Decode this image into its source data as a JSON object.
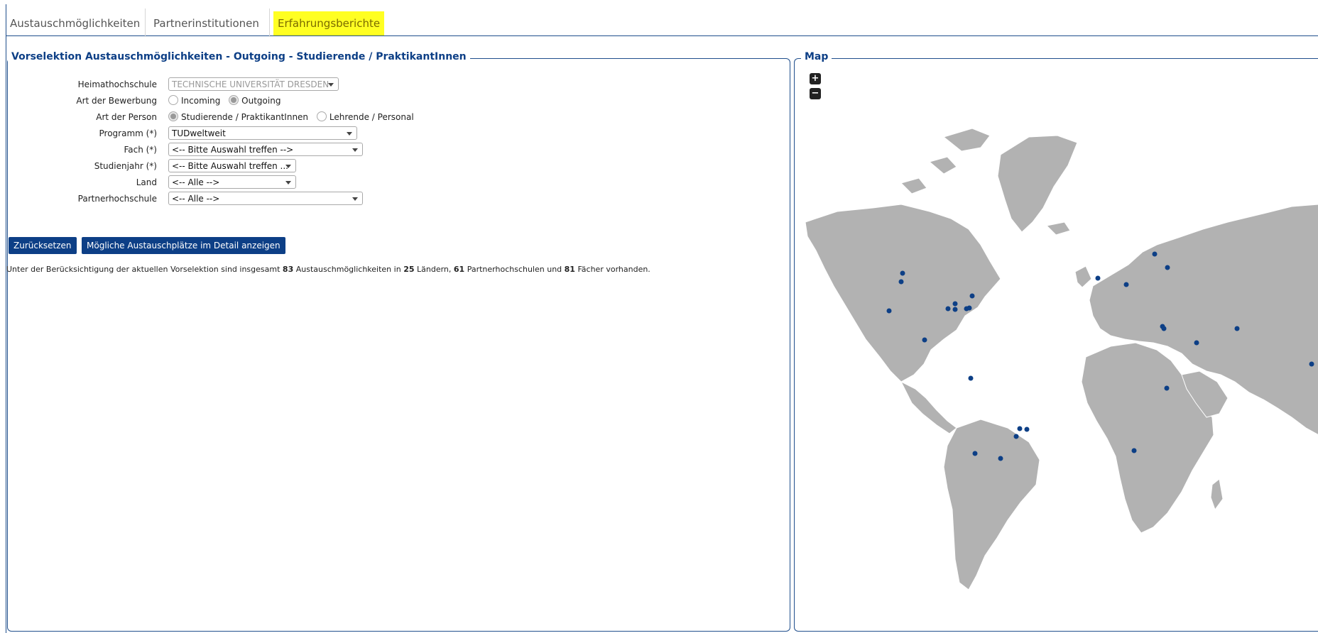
{
  "tabs": [
    {
      "label": "Austauschmöglichkeiten"
    },
    {
      "label": "Partnerinstitutionen"
    },
    {
      "label": "Erfahrungsberichte"
    }
  ],
  "selection": {
    "legend": "Vorselektion Austauschmöglichkeiten - Outgoing - Studierende / PraktikantInnen",
    "fields": {
      "heimathochschule": {
        "label": "Heimathochschule",
        "value": "TECHNISCHE UNIVERSITÄT DRESDEN"
      },
      "bewerbung": {
        "label": "Art der Bewerbung",
        "options": [
          "Incoming",
          "Outgoing"
        ],
        "selected": "Outgoing"
      },
      "person": {
        "label": "Art der Person",
        "options": [
          "Studierende / PraktikantInnen",
          "Lehrende / Personal"
        ],
        "selected": "Studierende / PraktikantInnen"
      },
      "programm": {
        "label": "Programm (*)",
        "value": "TUDweltweit"
      },
      "fach": {
        "label": "Fach (*)",
        "value": "<-- Bitte Auswahl treffen -->"
      },
      "studienjahr": {
        "label": "Studienjahr (*)",
        "value": "<-- Bitte Auswahl treffen ..."
      },
      "land": {
        "label": "Land",
        "value": "<-- Alle -->"
      },
      "partnerhochschule": {
        "label": "Partnerhochschule",
        "value": "<-- Alle -->"
      }
    },
    "buttons": {
      "reset": "Zurücksetzen",
      "details": "Mögliche Austauschplätze im Detail anzeigen"
    },
    "summary": {
      "prefix": "Unter der Berücksichtigung der aktuellen Vorselektion sind insgesamt",
      "count_exchanges": "83",
      "mid1": "Austauschmöglichkeiten in",
      "count_countries": "25",
      "mid2": "Ländern,",
      "count_partners": "61",
      "mid3": "Partnerhochschulen und",
      "count_subjects": "81",
      "suffix": "Fächer vorhanden."
    }
  },
  "map": {
    "legend": "Map",
    "zoom_in": "+",
    "zoom_out": "−",
    "land_color": "#b2b2b2",
    "marker_color": "#0d3f86"
  },
  "colors": {
    "accent": "#0d3f86",
    "tab_highlight": "#ffff22"
  }
}
